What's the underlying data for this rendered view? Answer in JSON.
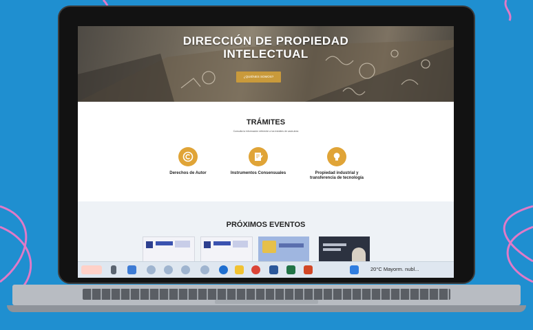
{
  "hero": {
    "title_line1": "DIRECCIÓN DE PROPIEDAD",
    "title_line2": "INTELECTUAL",
    "button_label": "¿QUIÉNES SOMOS?"
  },
  "tramites": {
    "title": "TRÁMITES",
    "subtitle": "Consulta la información referente a los trámites de cada área",
    "items": [
      {
        "label": "Derechos de Autor",
        "icon": "copyright-icon"
      },
      {
        "label": "Instrumentos Consensuales",
        "icon": "document-pen-icon"
      },
      {
        "label_line1": "Propiedad industrial y",
        "label_line2": "transferencia de tecnología",
        "icon": "lightbulb-icon"
      }
    ]
  },
  "eventos": {
    "title": "PRÓXIMOS EVENTOS"
  },
  "taskbar": {
    "weather": "20°C  Mayorm. nubl..."
  },
  "colors": {
    "accent": "#e0a437",
    "background": "#1f8fd0"
  }
}
